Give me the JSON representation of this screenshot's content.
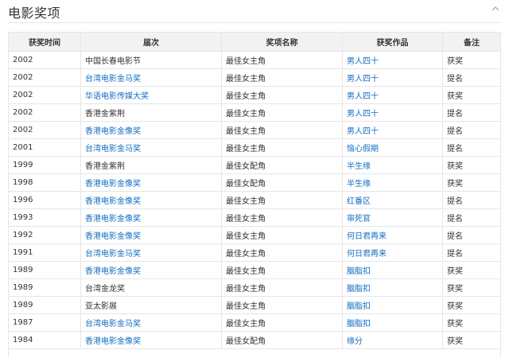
{
  "section": {
    "title": "电影奖项"
  },
  "table": {
    "headers": [
      "获奖时间",
      "届次",
      "奖项名称",
      "获奖作品",
      "备注"
    ],
    "rows": [
      {
        "year": "2002",
        "event": "中国长春电影节",
        "event_link": false,
        "award": "最佳女主角",
        "work": "男人四十",
        "note": "获奖"
      },
      {
        "year": "2002",
        "event": "台湾电影金马奖",
        "event_link": true,
        "award": "最佳女主角",
        "work": "男人四十",
        "note": "提名"
      },
      {
        "year": "2002",
        "event": "华语电影传媒大奖",
        "event_link": true,
        "award": "最佳女主角",
        "work": "男人四十",
        "note": "获奖"
      },
      {
        "year": "2002",
        "event": "香港金紫荆",
        "event_link": false,
        "award": "最佳女主角",
        "work": "男人四十",
        "note": "提名"
      },
      {
        "year": "2002",
        "event": "香港电影金像奖",
        "event_link": true,
        "award": "最佳女主角",
        "work": "男人四十",
        "note": "提名"
      },
      {
        "year": "2001",
        "event": "台湾电影金马奖",
        "event_link": true,
        "award": "最佳女主角",
        "work": "恼心假期",
        "note": "提名"
      },
      {
        "year": "1999",
        "event": "香港金紫荆",
        "event_link": false,
        "award": "最佳女配角",
        "work": "半生缘",
        "note": "获奖"
      },
      {
        "year": "1998",
        "event": "香港电影金像奖",
        "event_link": true,
        "award": "最佳女配角",
        "work": "半生缘",
        "note": "获奖"
      },
      {
        "year": "1996",
        "event": "香港电影金像奖",
        "event_link": true,
        "award": "最佳女主角",
        "work": "红番区",
        "note": "提名"
      },
      {
        "year": "1993",
        "event": "香港电影金像奖",
        "event_link": true,
        "award": "最佳女主角",
        "work": "审死官",
        "note": "提名"
      },
      {
        "year": "1992",
        "event": "香港电影金像奖",
        "event_link": true,
        "award": "最佳女主角",
        "work": "何日君再来",
        "note": "提名"
      },
      {
        "year": "1991",
        "event": "台湾电影金马奖",
        "event_link": true,
        "award": "最佳女主角",
        "work": "何日君再来",
        "note": "提名"
      },
      {
        "year": "1989",
        "event": "香港电影金像奖",
        "event_link": true,
        "award": "最佳女主角",
        "work": "胭脂扣",
        "note": "获奖"
      },
      {
        "year": "1989",
        "event": "台湾金龙奖",
        "event_link": false,
        "award": "最佳女主角",
        "work": "胭脂扣",
        "note": "获奖"
      },
      {
        "year": "1989",
        "event": "亚太影展",
        "event_link": false,
        "award": "最佳女主角",
        "work": "胭脂扣",
        "note": "获奖"
      },
      {
        "year": "1987",
        "event": "台湾电影金马奖",
        "event_link": true,
        "award": "最佳女主角",
        "work": "胭脂扣",
        "note": "获奖"
      },
      {
        "year": "1984",
        "event": "香港电影金像奖",
        "event_link": true,
        "award": "最佳女配角",
        "work": "缘分",
        "note": "获奖"
      }
    ]
  },
  "colors": {
    "link": "#136ec2",
    "header_bg": "#f2f2f2",
    "border": "#e6e6e6"
  }
}
